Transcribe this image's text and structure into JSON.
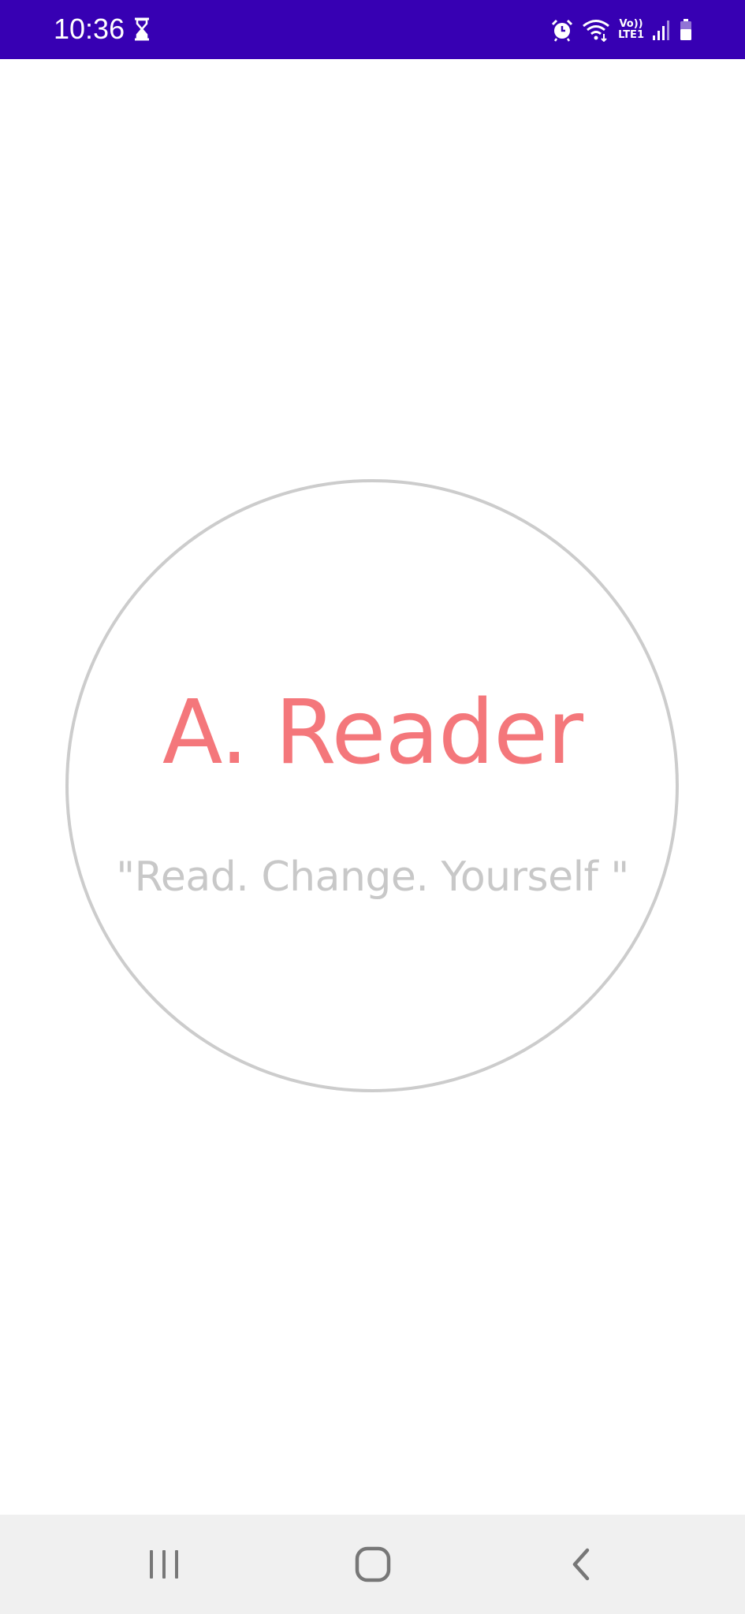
{
  "status_bar": {
    "time": "10:36",
    "background": "#3700b3",
    "icons": [
      "hourglass-icon",
      "alarm-icon",
      "wifi-icon",
      "volte-icon",
      "signal-icon",
      "battery-icon"
    ],
    "volte_label_top": "Vo))",
    "volte_label_bottom": "LTE1"
  },
  "splash": {
    "title": "A. Reader",
    "tagline": "\"Read. Change. Yourself \"",
    "title_color": "#f4777b",
    "tagline_color": "#c8c8c8",
    "circle_color": "#cccccc"
  },
  "nav_bar": {
    "buttons": [
      "recents-icon",
      "home-icon",
      "back-icon"
    ]
  }
}
